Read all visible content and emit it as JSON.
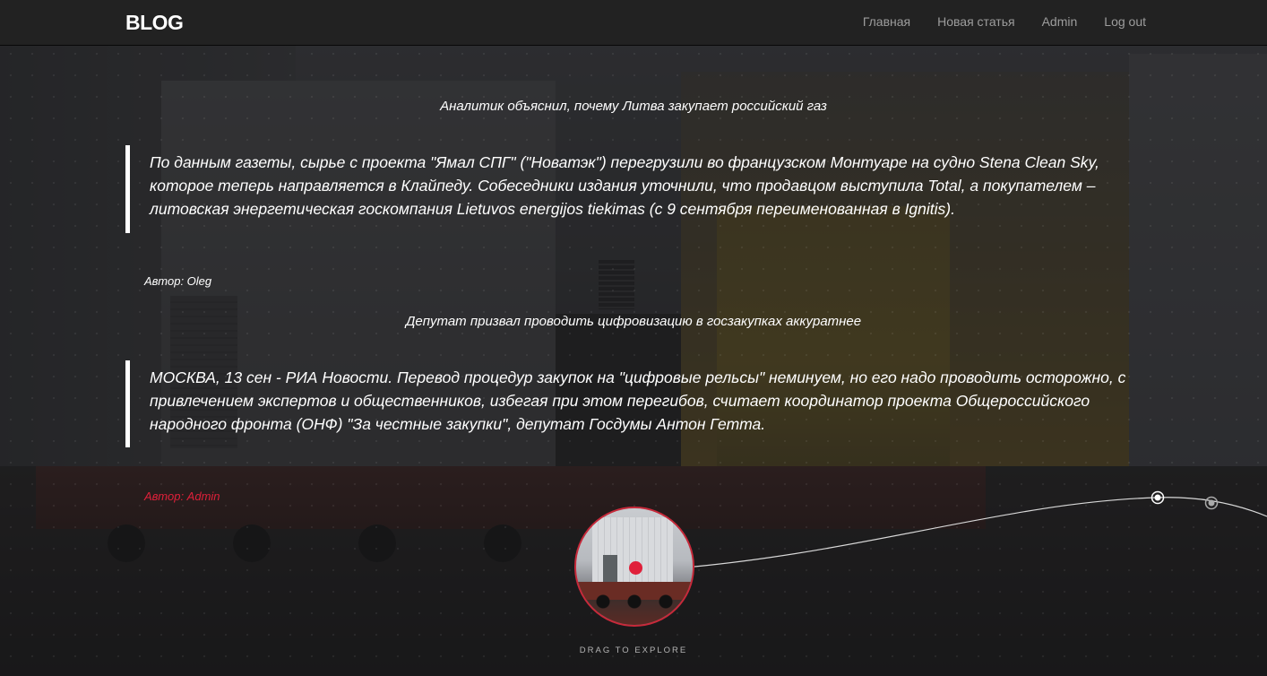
{
  "navbar": {
    "brand": "BLOG",
    "items": [
      {
        "label": "Главная"
      },
      {
        "label": "Новая статья"
      },
      {
        "label": "Admin"
      },
      {
        "label": "Log out"
      }
    ]
  },
  "posts": [
    {
      "title": "Аналитик объяснил, почему Литва закупает российский газ",
      "body": "По данным газеты, сырье с проекта \"Ямал СПГ\" (\"Новатэк\") перегрузили во французском Монтуаре на судно Stena Clean Sky, которое теперь направляется в Клайпеду. Собеседники издания уточнили, что продавцом выступила Total, а покупателем – литовская энергетическая госкомпания Lietuvos energijos tiekimas (с 9 сентября переименованная в Ignitis).",
      "author": "Автор: Oleg",
      "author_color": "#ffffff"
    },
    {
      "title": "Депутат призвал проводить цифровизацию в госзакупках аккуратнее",
      "body": "МОСКВА, 13 сен - РИА Новости. Перевод процедур закупок на \"цифровые рельсы\" неминуем, но его надо проводить осторожно, с привлечением экспертов и общественников, избегая при этом перегибов, считает координатор проекта Общероссийского народного фронта (ОНФ) \"За честные закупки\", депутат Госдумы Антон Гетта.",
      "author": "Автор: Admin",
      "author_color": "#e0203a"
    }
  ],
  "explore": {
    "label": "DRAG TO EXPLORE",
    "accent": "#c8293a"
  }
}
